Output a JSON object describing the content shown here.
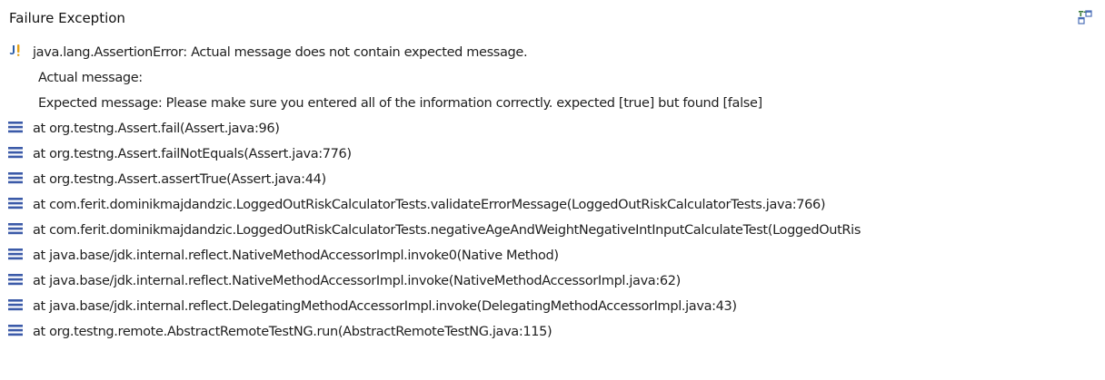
{
  "header": {
    "title": "Failure Exception",
    "action_icon": "stack-trace-filter-icon"
  },
  "exception": {
    "icon": "junit-failure-icon",
    "line1": "java.lang.AssertionError: Actual message does not contain expected message.",
    "line2": "Actual message:",
    "line3": "Expected message: Please make sure you entered all of the information correctly. expected [true] but found [false]"
  },
  "frames": [
    {
      "icon": "stack-frame-icon",
      "text": "at org.testng.Assert.fail(Assert.java:96)"
    },
    {
      "icon": "stack-frame-icon",
      "text": "at org.testng.Assert.failNotEquals(Assert.java:776)"
    },
    {
      "icon": "stack-frame-icon",
      "text": "at org.testng.Assert.assertTrue(Assert.java:44)"
    },
    {
      "icon": "stack-frame-icon",
      "text": "at com.ferit.dominikmajdandzic.LoggedOutRiskCalculatorTests.validateErrorMessage(LoggedOutRiskCalculatorTests.java:766)"
    },
    {
      "icon": "stack-frame-icon",
      "text": "at com.ferit.dominikmajdandzic.LoggedOutRiskCalculatorTests.negativeAgeAndWeightNegativeIntInputCalculateTest(LoggedOutRis"
    },
    {
      "icon": "stack-frame-icon",
      "text": "at java.base/jdk.internal.reflect.NativeMethodAccessorImpl.invoke0(Native Method)"
    },
    {
      "icon": "stack-frame-icon",
      "text": "at java.base/jdk.internal.reflect.NativeMethodAccessorImpl.invoke(NativeMethodAccessorImpl.java:62)"
    },
    {
      "icon": "stack-frame-icon",
      "text": "at java.base/jdk.internal.reflect.DelegatingMethodAccessorImpl.invoke(DelegatingMethodAccessorImpl.java:43)"
    },
    {
      "icon": "stack-frame-icon",
      "text": "at org.testng.remote.AbstractRemoteTestNG.run(AbstractRemoteTestNG.java:115)"
    }
  ],
  "colors": {
    "frame_icon": "#3b5aa8",
    "failure_icon_j": "#2c5ea8",
    "failure_icon_bang": "#e3a11a"
  }
}
